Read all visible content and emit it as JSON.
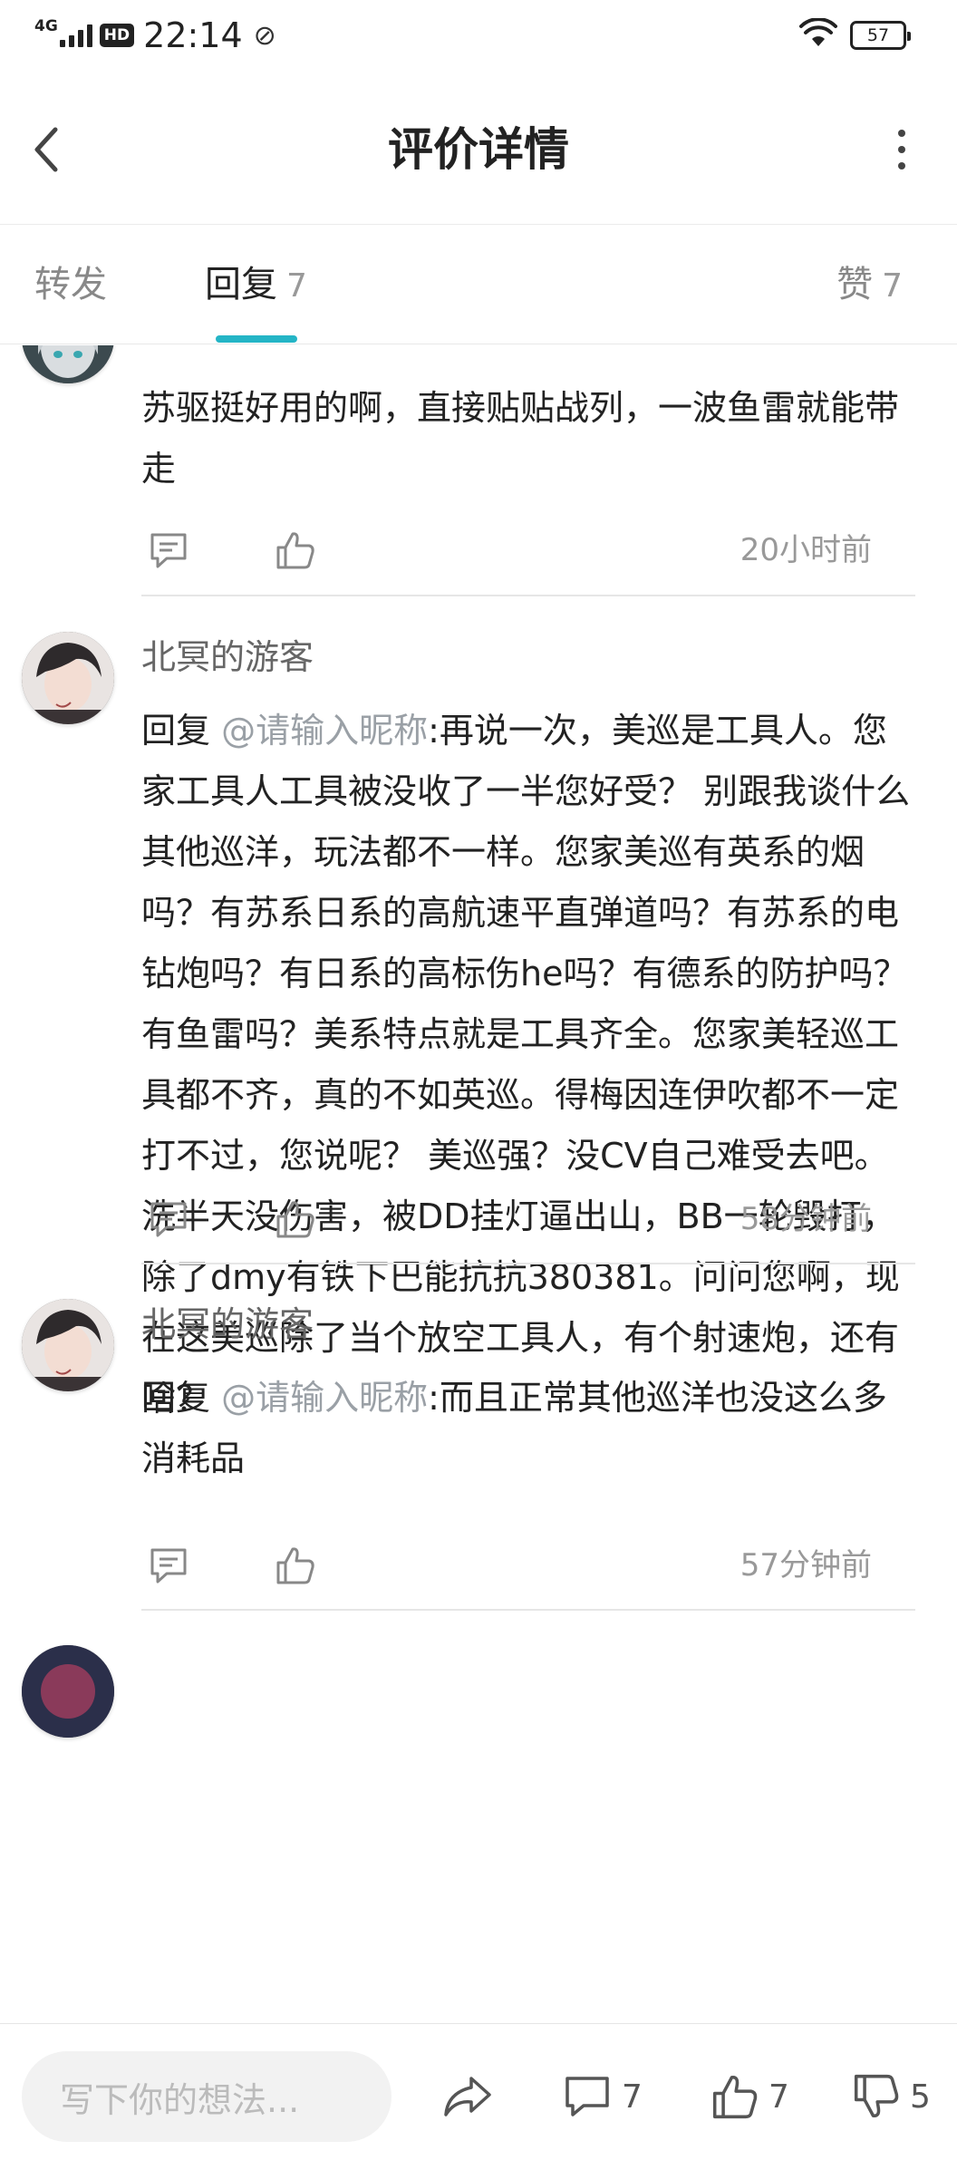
{
  "status_bar": {
    "network": "4G",
    "hd_label": "HD",
    "time": "22:14",
    "battery": "57"
  },
  "header": {
    "title": "评价详情"
  },
  "tabs": {
    "forward": {
      "label": "转发"
    },
    "reply": {
      "label": "回复",
      "count": "7"
    },
    "like": {
      "label": "赞",
      "count": "7"
    }
  },
  "comments": [
    {
      "username": "",
      "content": "苏驱挺好用的啊，直接贴贴战列，一波鱼雷就能带走",
      "time": "20小时前"
    },
    {
      "username": "北冥的游客",
      "reply_prefix": " 回复 ",
      "mention": "@请输入昵称",
      "content": ":再说一次，美巡是工具人。您家工具人工具被没收了一半您好受？ 别跟我谈什么其他巡洋，玩法都不一样。您家美巡有英系的烟吗？有苏系日系的高航速平直弹道吗？有苏系的电钻炮吗？有日系的高标伤he吗？有德系的防护吗？有鱼雷吗？美系特点就是工具齐全。您家美轻巡工具都不齐，真的不如英巡。得梅因连伊吹都不一定打不过，您说呢？ 美巡强？没CV自己难受去吧。洗半天没伤害，被DD挂灯逼出山，BB一轮毁打，除了dmy有铁下巴能抗抗380381。问问您啊，现在这美巡除了当个放空工具人，有个射速炮，还有啥？",
      "time": "58分钟前"
    },
    {
      "username": "北冥的游客",
      "reply_prefix": " 回复 ",
      "mention": "@请输入昵称",
      "content": ":而且正常其他巡洋也没这么多消耗品",
      "time": "57分钟前"
    }
  ],
  "bottom_bar": {
    "input_placeholder": "写下你的想法...",
    "comment_count": "7",
    "like_count": "7",
    "dislike_count": "5"
  },
  "icons": {
    "back": "chevron-left-icon",
    "more": "more-vertical-icon",
    "comment": "comment-icon",
    "like": "thumbs-up-icon",
    "share": "share-icon",
    "dislike": "thumbs-down-icon"
  },
  "colors": {
    "accent": "#24b5c6",
    "mention": "#9aa0a6",
    "muted": "#999999"
  }
}
